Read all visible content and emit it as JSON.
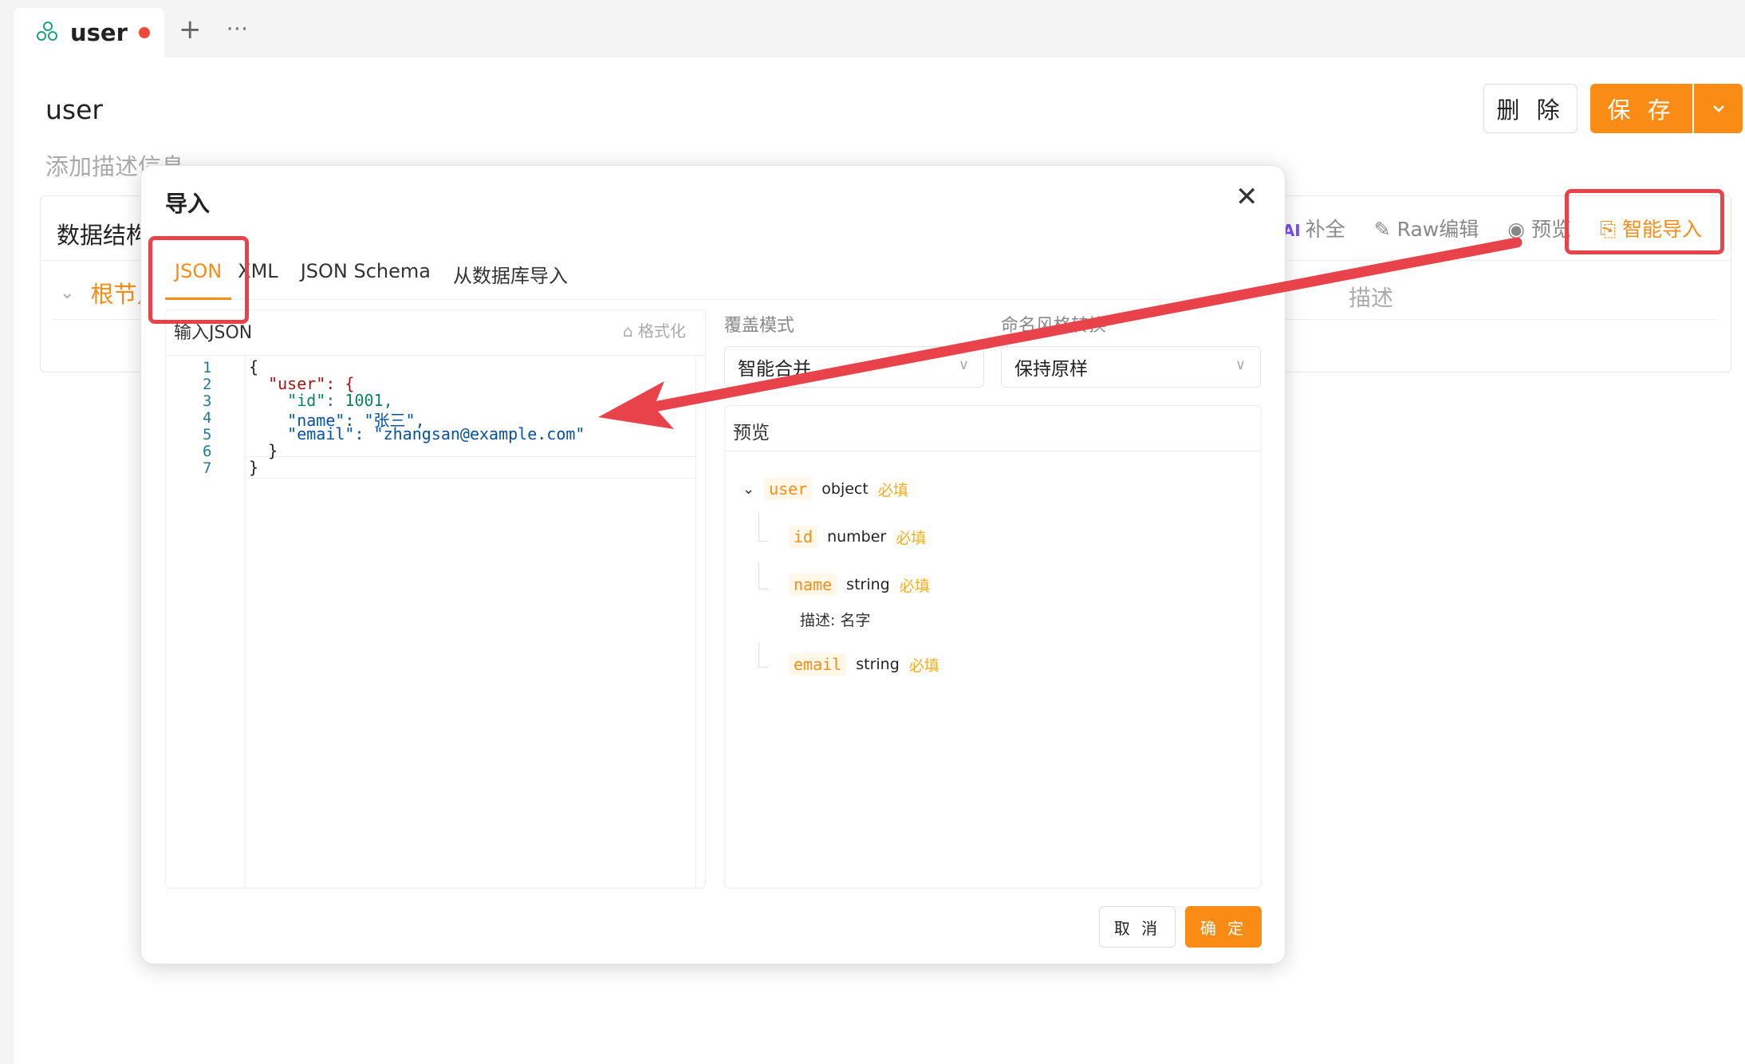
{
  "tab": {
    "label": "user",
    "unsaved": true
  },
  "page": {
    "title": "user",
    "description_placeholder": "添加描述信息",
    "delete_label": "删 除",
    "save_label": "保 存"
  },
  "structure": {
    "title": "数据结构",
    "toolbar": {
      "ai_badge": "AI",
      "complete_label": "补全",
      "raw_edit_label": "Raw编辑",
      "preview_label": "预览",
      "smart_import_label": "智能导入"
    },
    "root_label": "根节点",
    "desc_column": "描述"
  },
  "modal": {
    "title": "导入",
    "tabs": [
      "JSON",
      "XML",
      "JSON Schema",
      "从数据库导入"
    ],
    "active_tab": "JSON",
    "editor": {
      "header": "输入JSON",
      "format_label": "格式化",
      "lines": [
        "{",
        "  \"user\": {",
        "    \"id\": 1001,",
        "    \"name\": \"张三\",",
        "    \"email\": \"zhangsan@example.com\"",
        "  }",
        "}"
      ]
    },
    "overwrite_mode": {
      "label": "覆盖模式",
      "value": "智能合并"
    },
    "naming_style": {
      "label": "命名风格转换",
      "value": "保持原样"
    },
    "preview": {
      "title": "预览",
      "root": {
        "key": "user",
        "type": "object",
        "required": "必填"
      },
      "children": [
        {
          "key": "id",
          "type": "number",
          "required": "必填",
          "description": ""
        },
        {
          "key": "name",
          "type": "string",
          "required": "必填",
          "description": "描述: 名字"
        },
        {
          "key": "email",
          "type": "string",
          "required": "必填",
          "description": ""
        }
      ]
    },
    "cancel_label": "取 消",
    "ok_label": "确 定"
  },
  "colors": {
    "accent": "#fa8c16",
    "annotation": "#e8434a",
    "required": "#faad14"
  }
}
